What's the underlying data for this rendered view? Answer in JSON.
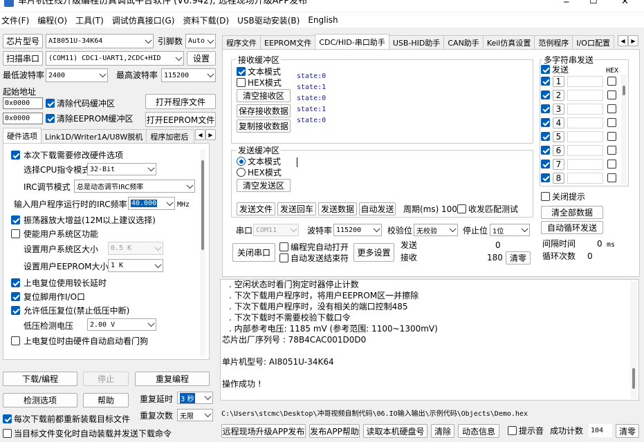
{
  "window": {
    "title": "单片机在线升级编程仿真调试平台软件 (V6.942), 远程现场升级APP发布",
    "min": "─",
    "max": "☐",
    "close": "✕"
  },
  "menu": [
    "文件(F)",
    "编程(O)",
    "工具(T)",
    "调试仿真接口(G)",
    "资料下载(D)",
    "USB驱动安装(B)",
    "English"
  ],
  "left": {
    "chip_label": "芯片型号",
    "chip_value": "AI8051U-34K64",
    "pin_label": "引脚数",
    "pin_value": "Auto",
    "scan_label": "扫描串口",
    "port_value": "(COM11) CDC1-UART1,2CDC+HID",
    "settings_label": "设置",
    "min_baud_label": "最低波特率",
    "min_baud_value": "2400",
    "max_baud_label": "最高波特率",
    "max_baud_value": "115200",
    "start_addr_label": "起始地址",
    "code_addr": "0x0000",
    "clear_code_label": "清除代码缓冲区",
    "open_prog_label": "打开程序文件",
    "eeprom_addr": "0x0000",
    "clear_eeprom_label": "清除EEPROM缓冲区",
    "open_eeprom_label": "打开EEPROM文件",
    "tabs": [
      "硬件选项",
      "Link1D/Writer1A/U8W脱机",
      "程序加密后"
    ],
    "opt_modify_hw": "本次下载需要修改硬件选项",
    "cpu_mode_label": "选择CPU指令模式",
    "cpu_mode_value": "32-Bit",
    "irc_label": "IRC调节模式",
    "irc_value": "总是动态调节IRC频率",
    "irc_freq_label": "输入用户程序运行时的IRC频率",
    "irc_freq_value": "40.000",
    "irc_unit": "MHz",
    "osc_gain": "振荡器放大增益(12M以上建议选择)",
    "use_sys_area": "使能用户系统区功能",
    "sys_area_size_label": "设置用户系统区大小",
    "sys_area_size_value": "0.5 K",
    "eeprom_size_label": "设置用户EEPROM大小",
    "eeprom_size_value": "1   K",
    "power_reset": "上电复位使用较长延时",
    "reset_pin": "复位脚用作I/O口",
    "lvr": "允许低压复位(禁止低压中断)",
    "lvd_label": "低压检测电压",
    "lvd_value": "2.00 V",
    "wdt": "上电复位时由硬件自动启动看门狗",
    "download_label": "下载/编程",
    "stop_label": "停止",
    "reprogram_label": "重复编程",
    "check_label": "检测选项",
    "help_label": "帮助",
    "repeat_delay_label": "重复延时",
    "repeat_delay_value": "3 秒",
    "repeat_count_label": "重复次数",
    "repeat_count_value": "无限",
    "reload_label": "每次下载前都重新装载目标文件",
    "auto_send_label": "当目标文件变化时自动装载并发送下载命令"
  },
  "right": {
    "tabs": [
      "程序文件",
      "EEPROM文件",
      "CDC/HID-串口助手",
      "USB-HID助手",
      "CAN助手",
      "Keil仿真设置",
      "范例程序",
      "I/O口配置"
    ],
    "rx_title": "接收缓冲区",
    "rx_text_mode": "文本模式",
    "rx_hex_mode": "HEX模式",
    "rx_clear": "清空接收区",
    "rx_save": "保存接收数据",
    "rx_copy": "复制接收数据",
    "rx_lines": [
      "state:0",
      "state:1",
      "state:0",
      "state:1",
      "state:0"
    ],
    "tx_title": "发送缓冲区",
    "tx_text_mode": "文本模式",
    "tx_hex_mode": "HEX模式",
    "tx_clear": "清空发送区",
    "send_file": "发送文件",
    "send_return": "发送回车",
    "send_data": "发送数据",
    "auto_send": "自动发送",
    "period_label": "周期(ms)",
    "period_value": "100",
    "recv_match": "收发匹配测试",
    "port_label": "串口",
    "port_value": "COM11",
    "baud_label": "波特率",
    "baud_value": "115200",
    "parity_label": "校验位",
    "parity_value": "无校验",
    "stop_label": "停止位",
    "stop_value": "1位",
    "close_port": "关闭串口",
    "auto_open": "编程完自动打开",
    "auto_end": "自动发送结束符",
    "more_settings": "更多设置",
    "send_count_label": "发送",
    "send_count": "0",
    "recv_count_label": "接收",
    "recv_count": "180",
    "clear_count": "清零",
    "multi_title": "多字符串发送",
    "multi_send_head": "发送",
    "multi_hex_head": "HEX",
    "multi_rows": [
      "1",
      "2",
      "3",
      "4",
      "5",
      "6",
      "7",
      "8"
    ],
    "close_hint": "关闭提示",
    "clear_all": "清全部数据",
    "auto_loop": "自动循环发送",
    "interval_label": "间隔时间",
    "interval_value": "0",
    "interval_unit": "ms",
    "loop_label": "循环次数",
    "loop_value": "0"
  },
  "log": [
    ". 空闲状态时看门狗定时器停止计数",
    ". 下次下载用户程序时，将用户EEPROM区一并擦除",
    ". 下次下载用户程序时，没有相关的端口控制485",
    ". 下次下载时不需要校验下载口令",
    ". 内部参考电压: 1185 mV (参考范围: 1100~1300mV)",
    "芯片出厂序列号 : 78B4CAC001D0D0",
    "",
    "  单片机型号: AI8051U-34K64",
    "",
    "操作成功 !"
  ],
  "file_path": "C:\\Users\\stcmc\\Desktop\\冲哥视频自制代码\\06.IO输入输出\\示例代码\\Objects\\Demo.hex",
  "bottom": {
    "remote_upgrade": "远程现场升级APP发布",
    "publish_help": "发布APP帮助",
    "read_disk": "读取本机硬盘号",
    "clear": "清除",
    "animation": "动态信息",
    "prompt": "提示音",
    "success_label": "成功计数",
    "success_value": "104",
    "clear_zero": "清零"
  },
  "colors": {
    "accent": "#005fb8",
    "state_text": "#1a1aa6"
  }
}
